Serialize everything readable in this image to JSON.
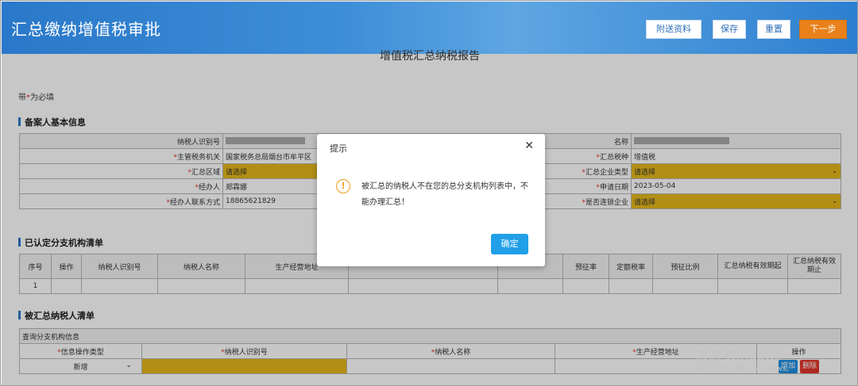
{
  "header": {
    "title": "汇总缴纳增值税审批",
    "buttons": {
      "attach": "附送资料",
      "save": "保存",
      "reset": "重置",
      "next": "下一步"
    }
  },
  "subtitle": "增值税汇总纳税报告",
  "required_note": {
    "prefix": "带",
    "star": "*",
    "suffix": "为必填"
  },
  "section1": {
    "title": "备案人基本信息",
    "taxpayer_id_label": "纳税人识别号",
    "name_label": "名称",
    "tax_authority_label": "主管税务机关",
    "tax_authority_value": "国家税务总局烟台市牟平区",
    "tax_type_label": "汇总税种",
    "tax_type_value": "增值税",
    "region_label": "汇总区域",
    "region_value": "请选择",
    "enterprise_type_label": "汇总企业类型",
    "enterprise_type_value": "请选择",
    "agent_label": "经办人",
    "agent_value": "郑霖娜",
    "apply_date_label": "申请日期",
    "apply_date_value": "2023-05-04",
    "agent_phone_label": "经办人联系方式",
    "agent_phone_value": "18865621829",
    "chain_label": "是否连锁企业",
    "chain_value": "请选择"
  },
  "section2": {
    "title": "已认定分支机构清单",
    "headers": [
      "序号",
      "操作",
      "纳税人识别号",
      "纳税人名称",
      "生产经营地址",
      "",
      "",
      "预征率",
      "定额税率",
      "预征比例",
      "汇总纳税有效期起",
      "汇总纳税有效期止"
    ],
    "row_index": "1"
  },
  "section3": {
    "title": "被汇总纳税人清单",
    "query_label": "查询分支机构信息",
    "headers": [
      "信息操作类型",
      "纳税人识别号",
      "纳税人名称",
      "生产经营地址",
      "操作"
    ],
    "op_type_value": "新增",
    "add_label": "增加",
    "delete_label": "删除"
  },
  "dialog": {
    "title": "提示",
    "message": "被汇总的纳税人不在您的总分支机构列表中，不能办理汇总！",
    "ok": "确定"
  },
  "watermark": {
    "line1": "激活 Windows",
    "line2": "转到\"设置\"以激活 Windows。"
  },
  "colors": {
    "header_blue": "#2a78c9",
    "required_yellow": "#e5b81a",
    "ok_blue": "#21a0e8",
    "next_orange": "#e8811a",
    "warn_orange": "#f09b1b"
  }
}
